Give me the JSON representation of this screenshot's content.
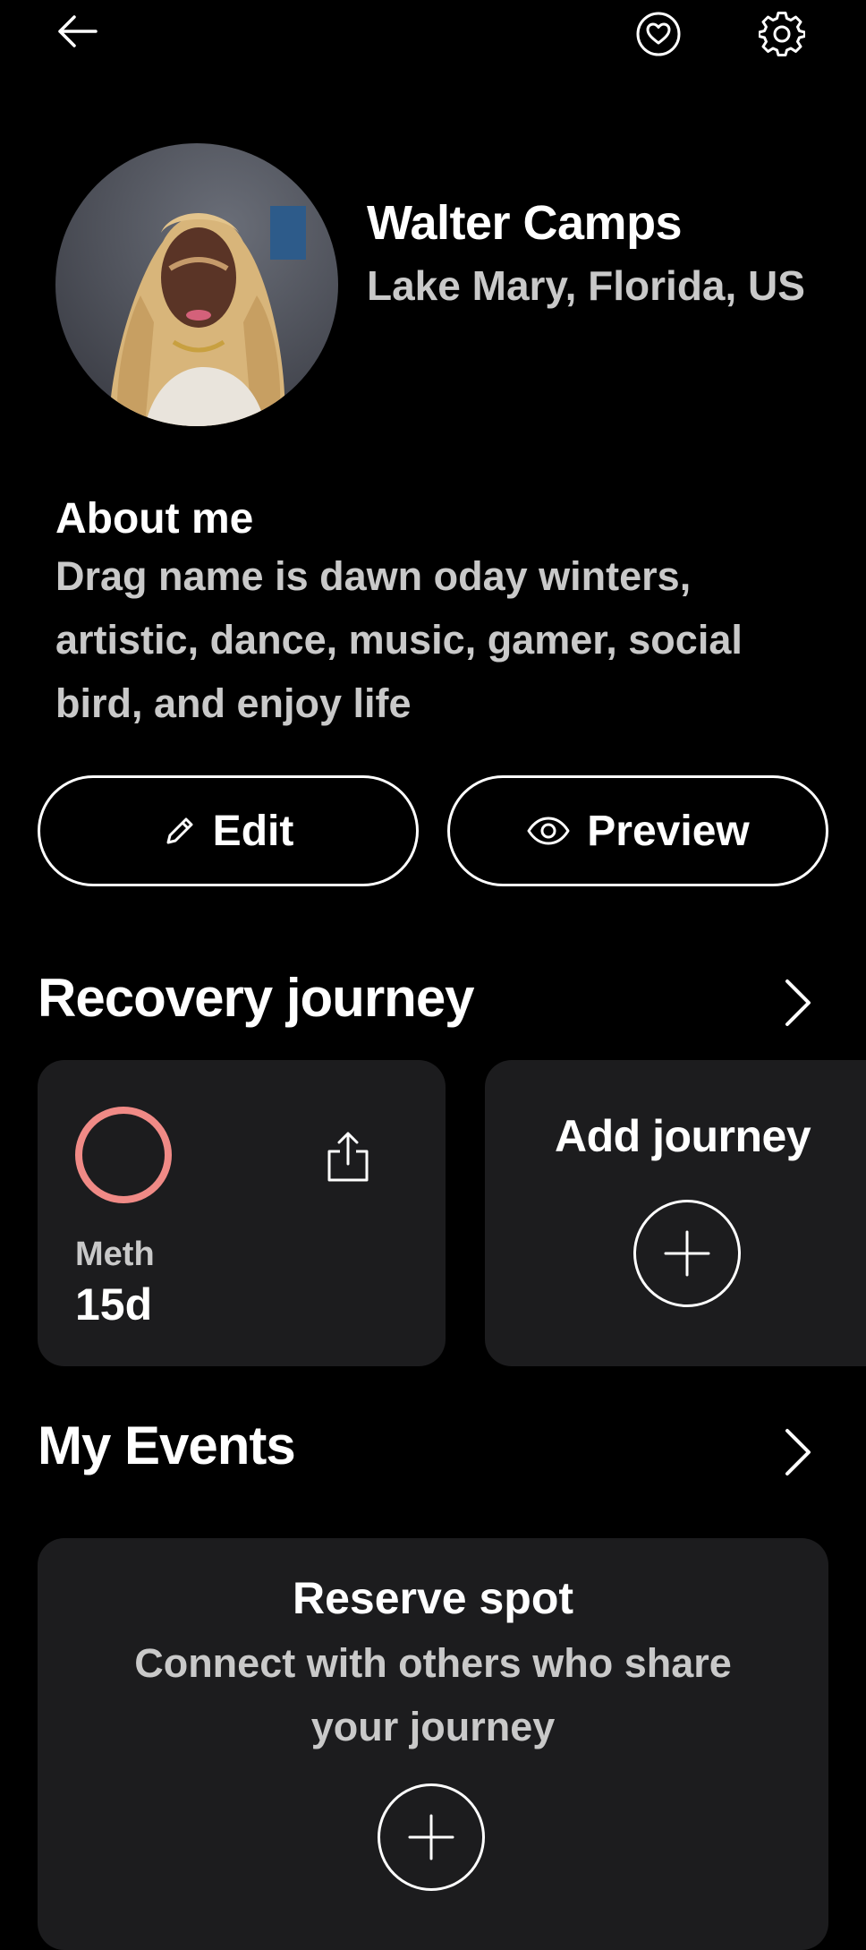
{
  "header": {
    "back_icon": "arrow-left-icon",
    "favorites_icon": "heart-in-circle-icon",
    "settings_icon": "gear-icon"
  },
  "profile": {
    "name": "Walter Camps",
    "location": "Lake Mary, Florida, US",
    "avatar_icon": "profile-photo"
  },
  "about": {
    "title": "About me",
    "text": "Drag name is dawn oday winters, artistic, dance, music, gamer, social bird, and enjoy life"
  },
  "actions": {
    "edit_label": "Edit",
    "edit_icon": "pencil-icon",
    "preview_label": "Preview",
    "preview_icon": "eye-icon"
  },
  "recovery": {
    "title": "Recovery journey",
    "journeys": [
      {
        "substance": "Meth",
        "days": "15d",
        "ring_color": "#f08a86"
      }
    ],
    "add_label": "Add journey"
  },
  "events": {
    "title": "My Events",
    "card_title": "Reserve spot",
    "card_text": "Connect with others who share your journey"
  },
  "colors": {
    "background": "#000000",
    "card": "#1c1c1e",
    "secondary_text": "#c9c9c9",
    "accent_ring": "#f08a86"
  }
}
